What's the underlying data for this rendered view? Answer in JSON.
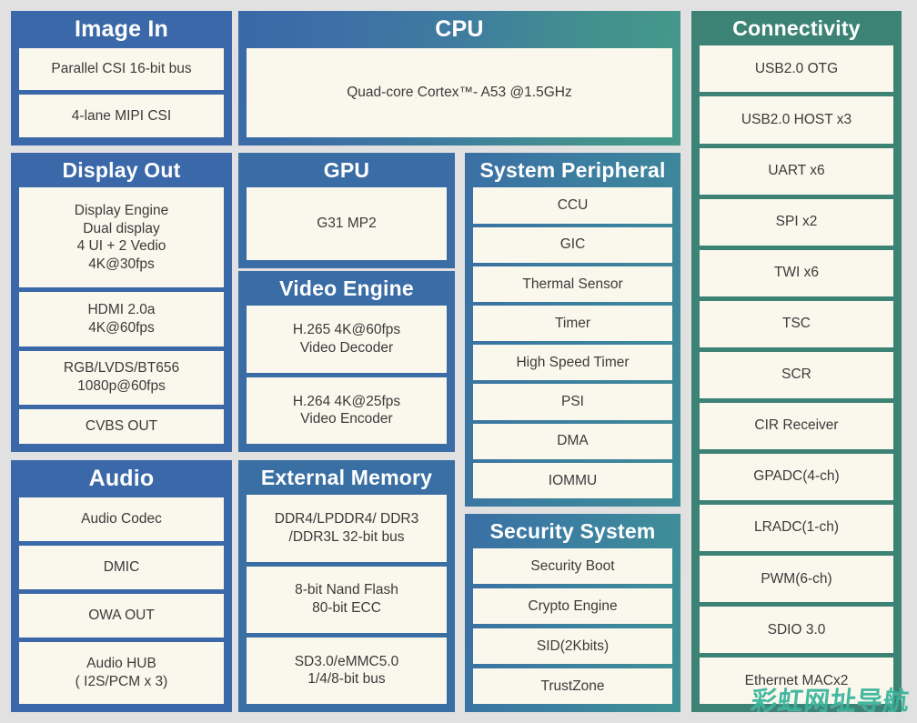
{
  "diagram": {
    "title": "SoC Block Diagram",
    "background_color": "#e2e1e1",
    "item_fill_color": "#faf7ec",
    "item_text_color": "#3b3b3b",
    "title_text_color": "#ffffff"
  },
  "blocks": {
    "image_in": {
      "title": "Image In",
      "accent": "#3a68a8",
      "items": [
        "Parallel CSI 16-bit bus",
        "4-lane MIPI CSI"
      ]
    },
    "cpu": {
      "title": "CPU",
      "accent": "#3f7c9f",
      "items": [
        "Quad-core Cortex™- A53 @1.5GHz"
      ]
    },
    "connectivity": {
      "title": "Connectivity",
      "accent": "#3d8375",
      "items": [
        "USB2.0 OTG",
        "USB2.0 HOST x3",
        "UART x6",
        "SPI x2",
        "TWI x6",
        "TSC",
        "SCR",
        "CIR Receiver",
        "GPADC(4-ch)",
        "LRADC(1-ch)",
        "PWM(6-ch)",
        "SDIO 3.0",
        "Ethernet MACx2"
      ]
    },
    "display_out": {
      "title": "Display Out",
      "accent": "#3a68a8",
      "items": [
        "Display Engine\nDual display\n4 UI  + 2 Vedio\n4K@30fps",
        "HDMI 2.0a\n4K@60fps",
        "RGB/LVDS/BT656\n1080p@60fps",
        "CVBS OUT"
      ]
    },
    "gpu": {
      "title": "GPU",
      "accent": "#3a6ca6",
      "items": [
        "G31 MP2"
      ]
    },
    "video_engine": {
      "title": "Video Engine",
      "accent": "#3a6ca6",
      "items": [
        "H.265 4K@60fps\nVideo Decoder",
        "H.264 4K@25fps\nVideo Encoder"
      ]
    },
    "system_peripheral": {
      "title": "System Peripheral",
      "accent": "#3c7ea0",
      "items": [
        "CCU",
        "GIC",
        "Thermal Sensor",
        "Timer",
        "High Speed Timer",
        "PSI",
        "DMA",
        "IOMMU"
      ]
    },
    "audio": {
      "title": "Audio",
      "accent": "#3a68a8",
      "items": [
        "Audio Codec",
        "DMIC",
        "OWA OUT",
        "Audio HUB\n( I2S/PCM x 3)"
      ]
    },
    "external_memory": {
      "title": "External Memory",
      "accent": "#3a6fa4",
      "items": [
        "DDR4/LPDDR4/ DDR3\n/DDR3L 32-bit bus",
        "8-bit Nand Flash\n80-bit ECC",
        "SD3.0/eMMC5.0\n1/4/8-bit bus"
      ]
    },
    "security_system": {
      "title": "Security System",
      "accent": "#3c81a0",
      "items": [
        "Security Boot",
        "Crypto Engine",
        "SID(2Kbits)",
        "TrustZone"
      ]
    }
  },
  "watermark": {
    "text": "彩虹网址导航",
    "color": "#35b39a"
  }
}
